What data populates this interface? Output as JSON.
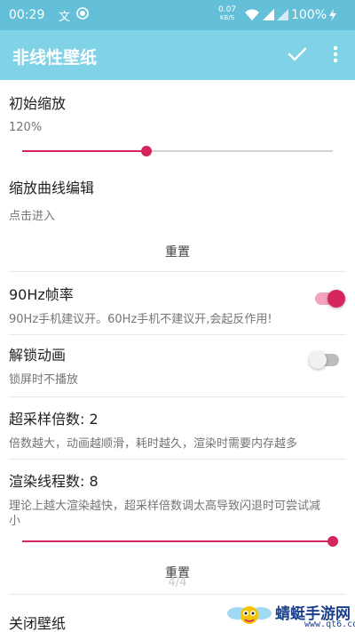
{
  "status_bar": {
    "time": "00:29",
    "speed_value": "0.07",
    "speed_unit": "KB/S",
    "battery": "100%",
    "icons": [
      "translate-icon",
      "record-icon",
      "wifi-icon",
      "signal-icon",
      "signal-icon",
      "charging-icon"
    ]
  },
  "app_bar": {
    "title": "非线性壁纸",
    "actions": [
      "check-icon",
      "more-vert-icon"
    ]
  },
  "settings": {
    "initial_zoom": {
      "title": "初始缩放",
      "value": "120%",
      "slider_fraction": 0.4
    },
    "zoom_curve": {
      "title": "缩放曲线编辑",
      "summary": "点击进入",
      "reset_label": "重置"
    },
    "fps_90hz": {
      "title": "90Hz帧率",
      "summary": "90Hz手机建议开。60Hz手机不建议开,会起反作用!",
      "enabled": true
    },
    "unlock_anim": {
      "title": "解锁动画",
      "summary": "锁屏时不播放",
      "enabled": false
    },
    "supersampling": {
      "title": "超采样倍数: 2",
      "summary": "倍数越大，动画越顺滑，耗时越久，渲染时需要内存越多"
    },
    "render_threads": {
      "title": "渲染线程数: 8",
      "summary_line1": "理论上越大渲染越快，超采样倍数调太高导致闪退时可尝试减",
      "summary_line2": "小",
      "slider_fraction": 1.0,
      "reset_label": "重置"
    },
    "close_wallpaper": {
      "title": "关闭壁纸"
    }
  },
  "page_indicator": "4/4",
  "watermark": {
    "name": "蜻蜓手游网",
    "url": "www.qt6.com"
  },
  "colors": {
    "accent": "#d6245c",
    "app_bar": "#80d2e6",
    "status_bar": "#64c0d9",
    "switch_on_track": "#f3a3bd",
    "switch_off_track": "#bdbdbd",
    "switch_off_thumb": "#f1f1f1"
  }
}
